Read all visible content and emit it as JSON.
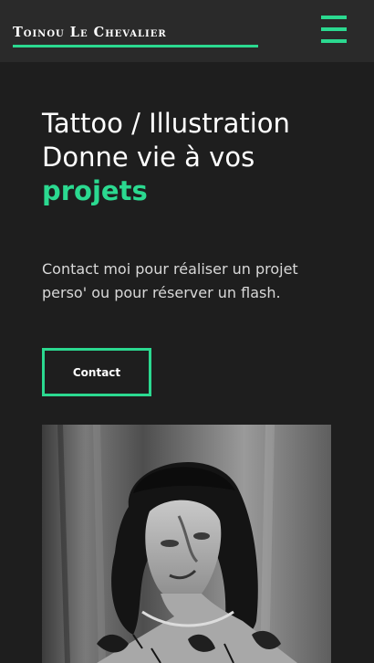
{
  "header": {
    "logo_text": "Toinou Le Chevalier",
    "menu_icon": "hamburger-menu-icon",
    "accent_color": "#2bd990"
  },
  "hero": {
    "title_line1": "Tattoo / Illustration",
    "title_line2": "Donne vie à vos",
    "title_accent": "projets",
    "subtitle": "Contact moi pour réaliser un projet perso' ou pour réserver un flash.",
    "cta_label": "Contact"
  },
  "photo": {
    "alt": "Portrait noir et blanc"
  }
}
